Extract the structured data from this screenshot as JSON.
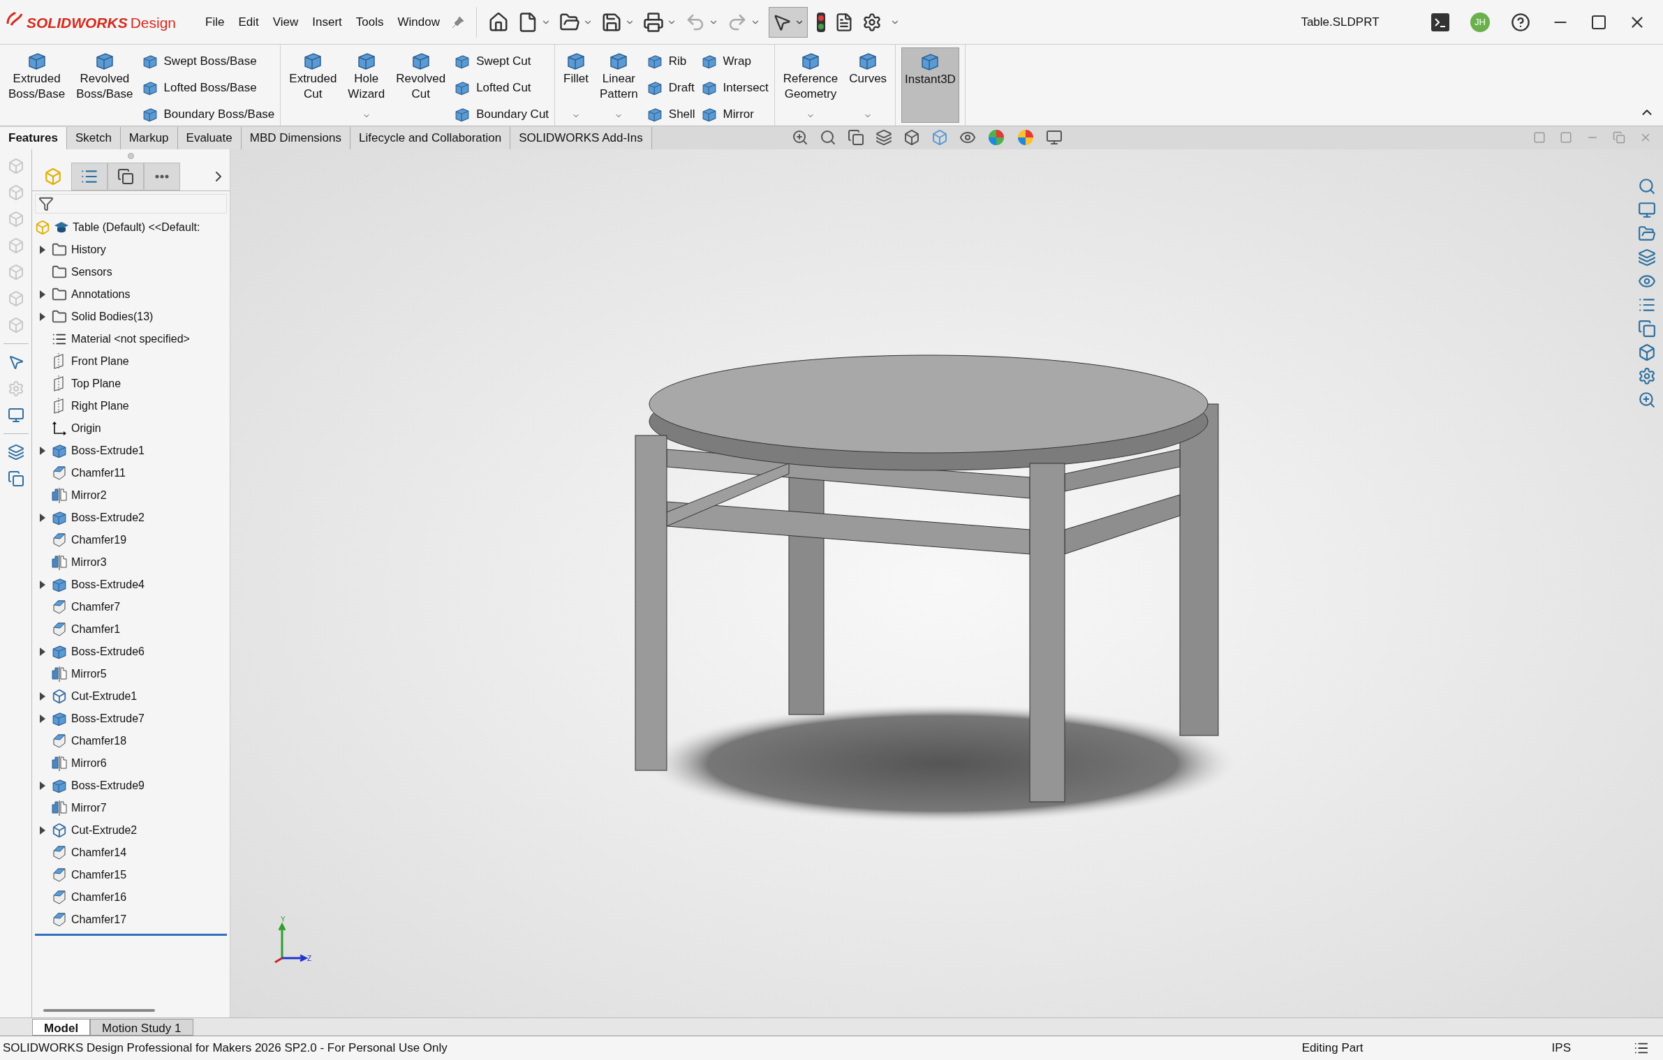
{
  "app": {
    "brand": "SOLIDWORKS",
    "brand_suffix": "Design",
    "title": "Table.SLDPRT",
    "avatar": "JH"
  },
  "menu": [
    "File",
    "Edit",
    "View",
    "Insert",
    "Tools",
    "Window"
  ],
  "select_tool": {
    "selected": true
  },
  "ribbon": [
    {
      "large": [
        {
          "label": "Extruded Boss/Base",
          "has_menu": false,
          "selected": false
        },
        {
          "label": "Revolved Boss/Base",
          "has_menu": false,
          "selected": false
        }
      ],
      "small_columns": [
        [
          "Swept Boss/Base",
          "Lofted Boss/Base",
          "Boundary Boss/Base"
        ]
      ]
    },
    {
      "large": [
        {
          "label": "Extruded Cut",
          "has_menu": false,
          "selected": false
        },
        {
          "label": "Hole Wizard",
          "has_menu": true,
          "selected": false
        },
        {
          "label": "Revolved Cut",
          "has_menu": false,
          "selected": false
        }
      ],
      "small_columns": [
        [
          "Swept Cut",
          "Lofted Cut",
          "Boundary Cut"
        ]
      ]
    },
    {
      "large": [
        {
          "label": "Fillet",
          "has_menu": true,
          "selected": false
        },
        {
          "label": "Linear Pattern",
          "has_menu": true,
          "selected": false
        }
      ],
      "small_columns": [
        [
          "Rib",
          "Draft",
          "Shell"
        ],
        [
          "Wrap",
          "Intersect",
          "Mirror"
        ]
      ]
    },
    {
      "large": [
        {
          "label": "Reference Geometry",
          "has_menu": true,
          "selected": false
        },
        {
          "label": "Curves",
          "has_menu": true,
          "selected": false
        }
      ]
    },
    {
      "large": [
        {
          "label": "Instant3D",
          "has_menu": false,
          "selected": true
        }
      ]
    }
  ],
  "tabs": [
    {
      "label": "Features",
      "selected": true
    },
    {
      "label": "Sketch",
      "selected": false
    },
    {
      "label": "Markup",
      "selected": false
    },
    {
      "label": "Evaluate",
      "selected": false
    },
    {
      "label": "MBD Dimensions",
      "selected": false
    },
    {
      "label": "Lifecycle and Collaboration",
      "selected": false
    },
    {
      "label": "SOLIDWORKS Add-Ins",
      "selected": false
    }
  ],
  "tree": {
    "root": {
      "label": "Table (Default) <<Default:"
    },
    "items": [
      {
        "label": "History",
        "kind": "folder",
        "expandable": true
      },
      {
        "label": "Sensors",
        "kind": "folder",
        "expandable": false
      },
      {
        "label": "Annotations",
        "kind": "folder",
        "expandable": true
      },
      {
        "label": "Solid Bodies(13)",
        "kind": "folder",
        "expandable": true
      },
      {
        "label": "Material <not specified>",
        "kind": "material",
        "expandable": false
      },
      {
        "label": "Front Plane",
        "kind": "plane",
        "expandable": false
      },
      {
        "label": "Top Plane",
        "kind": "plane",
        "expandable": false
      },
      {
        "label": "Right Plane",
        "kind": "plane",
        "expandable": false
      },
      {
        "label": "Origin",
        "kind": "origin",
        "expandable": false
      },
      {
        "label": "Boss-Extrude1",
        "kind": "extrude",
        "expandable": true
      },
      {
        "label": "Chamfer11",
        "kind": "chamfer",
        "expandable": false
      },
      {
        "label": "Mirror2",
        "kind": "mirror",
        "expandable": false
      },
      {
        "label": "Boss-Extrude2",
        "kind": "extrude",
        "expandable": true
      },
      {
        "label": "Chamfer19",
        "kind": "chamfer",
        "expandable": false
      },
      {
        "label": "Mirror3",
        "kind": "mirror",
        "expandable": false
      },
      {
        "label": "Boss-Extrude4",
        "kind": "extrude",
        "expandable": true
      },
      {
        "label": "Chamfer7",
        "kind": "chamfer",
        "expandable": false
      },
      {
        "label": "Chamfer1",
        "kind": "chamfer",
        "expandable": false
      },
      {
        "label": "Boss-Extrude6",
        "kind": "extrude",
        "expandable": true
      },
      {
        "label": "Mirror5",
        "kind": "mirror",
        "expandable": false
      },
      {
        "label": "Cut-Extrude1",
        "kind": "cut",
        "expandable": true
      },
      {
        "label": "Boss-Extrude7",
        "kind": "extrude",
        "expandable": true
      },
      {
        "label": "Chamfer18",
        "kind": "chamfer",
        "expandable": false
      },
      {
        "label": "Mirror6",
        "kind": "mirror",
        "expandable": false
      },
      {
        "label": "Boss-Extrude9",
        "kind": "extrude",
        "expandable": true
      },
      {
        "label": "Mirror7",
        "kind": "mirror",
        "expandable": false
      },
      {
        "label": "Cut-Extrude2",
        "kind": "cut",
        "expandable": true
      },
      {
        "label": "Chamfer14",
        "kind": "chamfer",
        "expandable": false
      },
      {
        "label": "Chamfer15",
        "kind": "chamfer",
        "expandable": false
      },
      {
        "label": "Chamfer16",
        "kind": "chamfer",
        "expandable": false
      },
      {
        "label": "Chamfer17",
        "kind": "chamfer",
        "expandable": false
      }
    ]
  },
  "triad": {
    "y": "Y",
    "z": "Z"
  },
  "bottom_tabs": [
    {
      "label": "Model",
      "selected": true
    },
    {
      "label": "Motion Study 1",
      "selected": false
    }
  ],
  "status_bar": {
    "message": "SOLIDWORKS Design Professional for Makers 2026 SP2.0 - For Personal Use Only",
    "mode": "Editing Part",
    "units": "IPS"
  }
}
